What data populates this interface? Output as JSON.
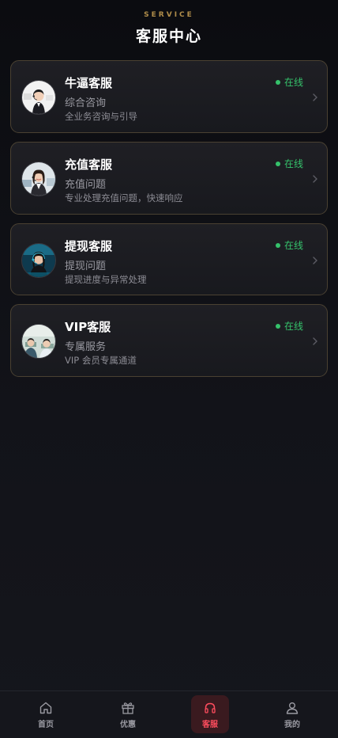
{
  "header": {
    "eyebrow": "SERVICE",
    "title": "客服中心"
  },
  "services": [
    {
      "name": "牛逼客服",
      "subtitle": "综合咨询",
      "description": "全业务咨询与引导",
      "status": "在线",
      "avatar_icon": "female-agent-headset-white-bg"
    },
    {
      "name": "充值客服",
      "subtitle": "充值问题",
      "description": "专业处理充值问题，快速响应",
      "status": "在线",
      "avatar_icon": "female-agent-headset-office"
    },
    {
      "name": "提现客服",
      "subtitle": "提现问题",
      "description": "提现进度与异常处理",
      "status": "在线",
      "avatar_icon": "female-agent-headset-blue"
    },
    {
      "name": "VIP客服",
      "subtitle": "专属服务",
      "description": "VIP 会员专属通道",
      "status": "在线",
      "avatar_icon": "agents-call-center"
    }
  ],
  "tabbar": {
    "items": [
      {
        "label": "首页",
        "icon": "home-icon",
        "active": false
      },
      {
        "label": "优惠",
        "icon": "gift-icon",
        "active": false
      },
      {
        "label": "客服",
        "icon": "headset-icon",
        "active": true
      },
      {
        "label": "我的",
        "icon": "user-icon",
        "active": false
      }
    ]
  },
  "colors": {
    "online": "#35c26b",
    "accent_gold": "#b08d4a",
    "active_tab": "#ff4d5e"
  }
}
